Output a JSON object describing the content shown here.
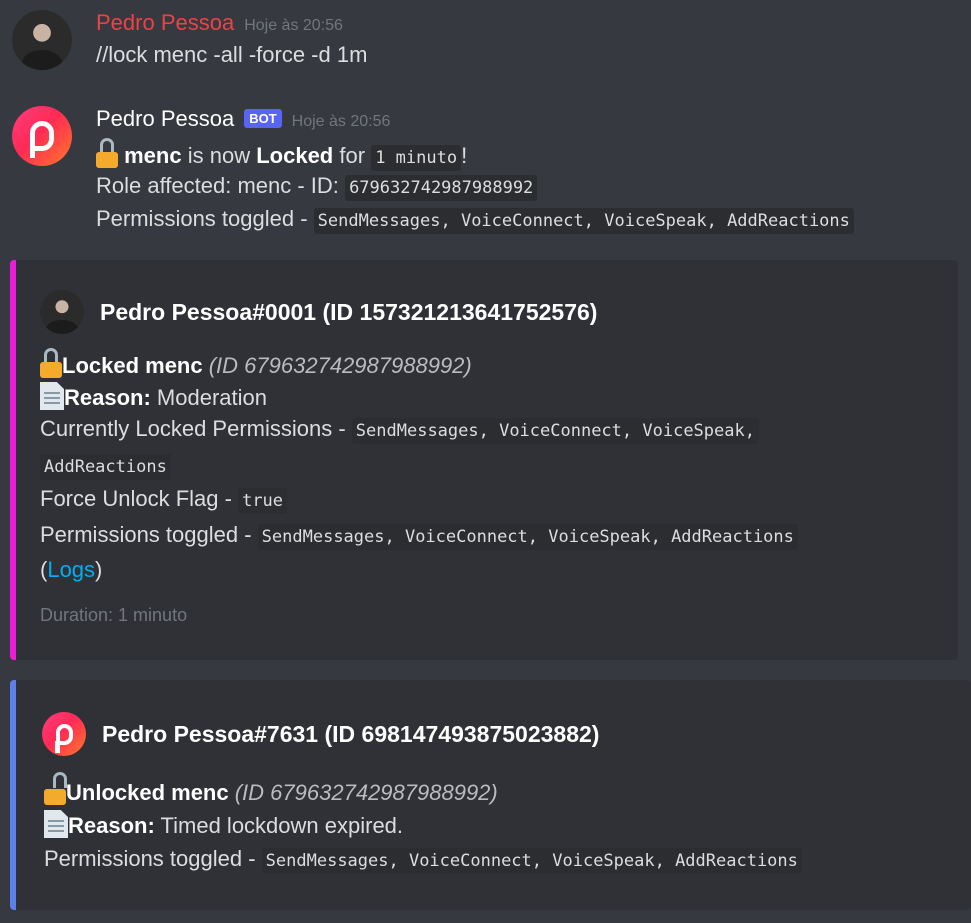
{
  "message1": {
    "username": "Pedro Pessoa",
    "timestamp": "Hoje às 20:56",
    "content": "//lock menc -all -force -d 1m"
  },
  "message2": {
    "username": "Pedro Pessoa",
    "bot_tag": "BOT",
    "timestamp": "Hoje às 20:56",
    "line1": {
      "role": "menc",
      "is_now": "is now",
      "locked": "Locked",
      "for": "for",
      "duration": "1 minuto",
      "end": "!"
    },
    "line2": {
      "label": "Role affected: menc  -  ID:",
      "id": "679632742987988992"
    },
    "line3": {
      "label": "Permissions toggled -",
      "perms": "SendMessages, VoiceConnect, VoiceSpeak, AddReactions"
    }
  },
  "embed1": {
    "author": "Pedro Pessoa#0001 (ID 157321213641752576)",
    "locked_title": "Locked menc",
    "locked_id": "(ID 679632742987988992)",
    "reason_label": "Reason:",
    "reason_value": "Moderation",
    "current_label": "Currently Locked Permissions -",
    "current_perms_a": "SendMessages, VoiceConnect, VoiceSpeak,",
    "current_perms_b": "AddReactions",
    "force_label": "Force Unlock Flag -",
    "force_value": "true",
    "toggled_label": "Permissions toggled -",
    "toggled_perms": "SendMessages, VoiceConnect, VoiceSpeak, AddReactions",
    "logs_open": "(",
    "logs_link": "Logs",
    "logs_close": ")",
    "footer": "Duration: 1 minuto",
    "bar_color": "#e91ed6"
  },
  "embed2": {
    "author": "Pedro Pessoa#7631 (ID 698147493875023882)",
    "unlocked_title": "Unlocked menc",
    "unlocked_id": "(ID 679632742987988992)",
    "reason_label": "Reason:",
    "reason_value": "Timed lockdown expired.",
    "toggled_label": "Permissions toggled -",
    "toggled_perms": "SendMessages, VoiceConnect, VoiceSpeak, AddReactions",
    "bar_color": "#5d7fe8"
  },
  "icons": {
    "lock": "lock-icon",
    "unlock": "unlock-icon",
    "page": "page-facing-up-icon"
  }
}
